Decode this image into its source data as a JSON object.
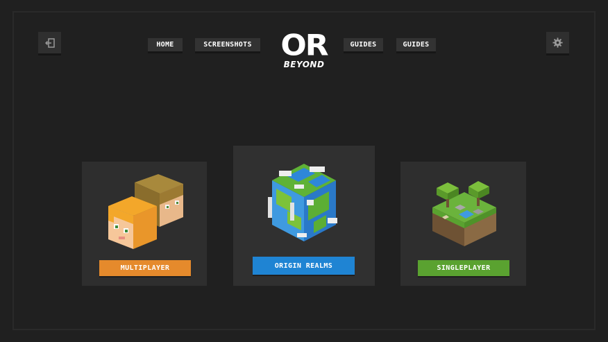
{
  "header": {
    "exit_icon": "exit-icon",
    "settings_icon": "gear-icon",
    "nav": {
      "home": "HOME",
      "screenshots": "SCREENSHOTS",
      "guides_1": "GUIDES",
      "guides_2": "GUIDES"
    },
    "logo": {
      "main": "OR",
      "sub": "BEYOND"
    }
  },
  "cards": {
    "multiplayer": {
      "label": "MULTIPLAYER",
      "color": "#e58a2c",
      "art": "two-player-heads-icon"
    },
    "origin_realms": {
      "label": "ORIGIN REALMS",
      "color": "#1f84d3",
      "art": "planet-cube-icon"
    },
    "singleplayer": {
      "label": "SINGLEPLAYER",
      "color": "#5aa230",
      "art": "grass-island-icon"
    }
  },
  "colors": {
    "background": "#202020",
    "card": "#2e2e2e",
    "nav_button": "#333333"
  }
}
